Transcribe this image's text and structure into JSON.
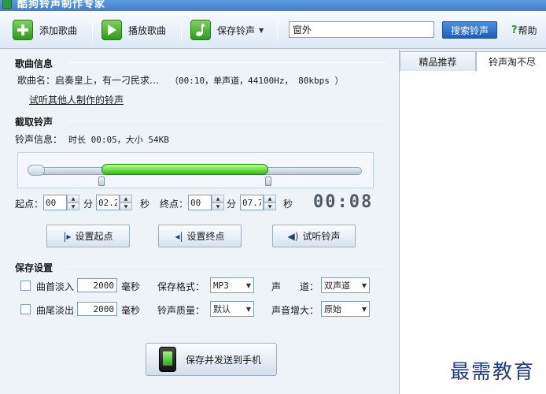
{
  "window": {
    "title": "酷狗铃声制作专家"
  },
  "toolbar": {
    "add_song": "添加歌曲",
    "play_song": "播放歌曲",
    "save_ringtone": "保存铃声",
    "search_value": "窗外",
    "search_button": "搜索铃声",
    "help": "帮助"
  },
  "song_info": {
    "section_title": "歌曲信息",
    "name_label": "歌曲名：",
    "name_value": "启奏皇上，有一刁民求…",
    "details": "（00:10，单声道，44100Hz， 80kbps ）",
    "try_link": "试听其他人制作的铃声"
  },
  "cut": {
    "section_title": "截取铃声",
    "info_label": "铃声信息：",
    "info_value": "时长 00:05，大小 54KB",
    "selection_start_fraction": 0.22,
    "selection_end_fraction": 0.72,
    "start_label": "起点：",
    "start_min": "00",
    "min_unit": "分",
    "start_sec": "02.2",
    "sec_unit": "秒",
    "end_label": "终点：",
    "end_min": "00",
    "end_sec": "07.7",
    "timer": "00:08",
    "set_start": "设置起点",
    "set_end": "设置终点",
    "preview": "试听铃声"
  },
  "save_settings": {
    "section_title": "保存设置",
    "fade_in": "曲首淡入",
    "fade_in_value": "2000",
    "fade_out": "曲尾淡出",
    "fade_out_value": "2000",
    "ms_unit": "毫秒",
    "format_label": "保存格式：",
    "format_value": "MP3",
    "channel_label": "声　　道：",
    "channel_value": "双声道",
    "quality_label": "铃声质量：",
    "quality_value": "默认",
    "volume_label": "声音增大：",
    "volume_value": "原始",
    "send_button": "保存并发送到手机"
  },
  "right_panel": {
    "tabs": [
      "精品推荐",
      "铃声淘不尽"
    ]
  },
  "watermark": "最需教育"
}
